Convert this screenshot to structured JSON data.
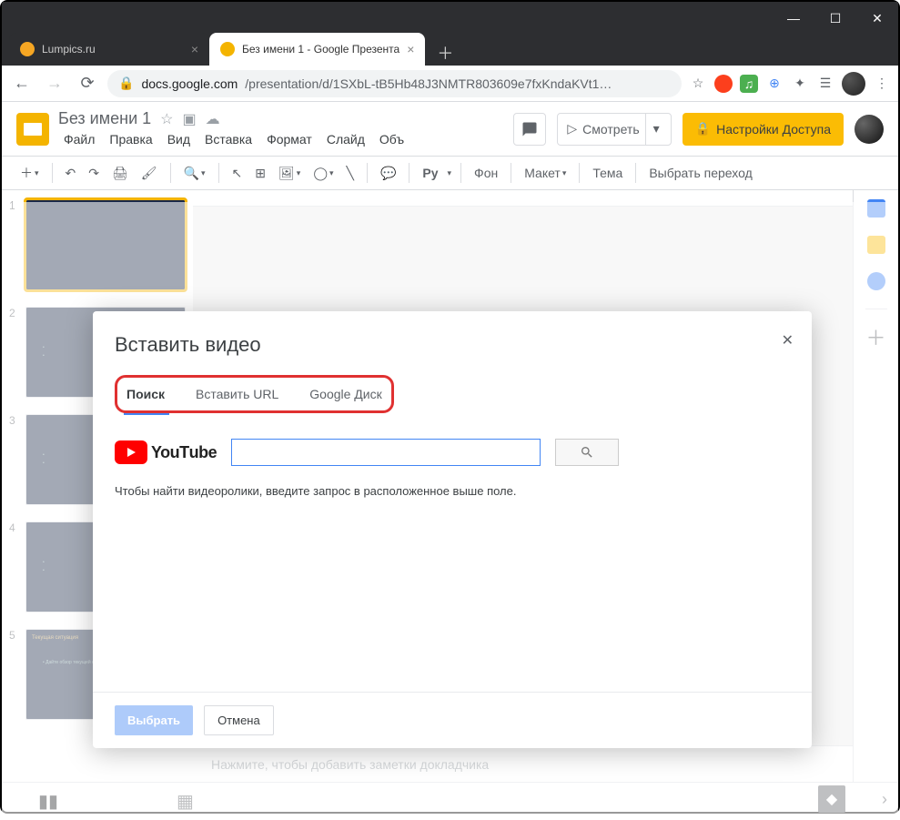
{
  "browser": {
    "tabs": [
      {
        "title": "Lumpics.ru",
        "fav": "#f5a623"
      },
      {
        "title": "Без имени 1 - Google Презента",
        "fav": "#f4b400"
      }
    ],
    "url_lock": "🔒",
    "url_host": "docs.google.com",
    "url_path": "/presentation/d/1SXbL-tB5Hb48J3NMTR803609e7fxKndaKVt1…"
  },
  "app": {
    "doc_title": "Без имени 1",
    "menus": [
      "Файл",
      "Правка",
      "Вид",
      "Вставка",
      "Формат",
      "Слайд",
      "Объ"
    ],
    "present_label": "Смотреть",
    "share_label": "Настройки Доступа"
  },
  "toolbar": {
    "py_label": "Py",
    "background": "Фон",
    "layout": "Макет",
    "theme": "Тема",
    "transition": "Выбрать переход"
  },
  "thumbs": {
    "nums": [
      "1",
      "2",
      "3",
      "4",
      "5"
    ],
    "slide5_title": "Текущая ситуация",
    "slide5_bullet": "Дайте обзор текущей ситуации"
  },
  "notes": {
    "placeholder": "Нажмите, чтобы добавить заметки докладчика"
  },
  "dialog": {
    "title": "Вставить видео",
    "tabs": [
      "Поиск",
      "Вставить URL",
      "Google Диск"
    ],
    "youtube_text": "YouТube",
    "hint": "Чтобы найти видеоролики, введите запрос в расположенное выше поле.",
    "select_btn": "Выбрать",
    "cancel_btn": "Отмена"
  }
}
